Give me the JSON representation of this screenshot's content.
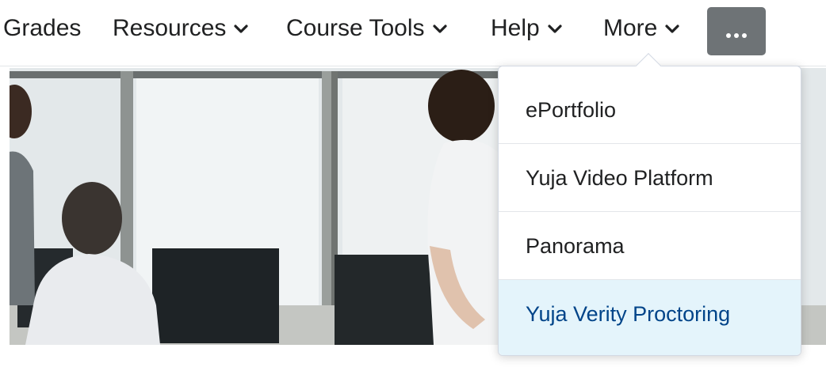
{
  "navbar": {
    "items": [
      {
        "label": "Grades",
        "has_dropdown": false
      },
      {
        "label": "Resources",
        "has_dropdown": true
      },
      {
        "label": "Course Tools",
        "has_dropdown": true
      },
      {
        "label": "Help",
        "has_dropdown": true
      },
      {
        "label": "More",
        "has_dropdown": true
      }
    ],
    "overflow_button_icon": "ellipsis-icon"
  },
  "dropdown": {
    "items": [
      {
        "label": "ePortfolio"
      },
      {
        "label": "Yuja Video Platform"
      },
      {
        "label": "Panorama"
      },
      {
        "label": "Yuja Verity Proctoring",
        "highlighted": true
      }
    ]
  },
  "colors": {
    "overflow_button_bg": "#6e7376",
    "highlight_bg": "#e4f4fb",
    "highlight_text": "#004489"
  }
}
